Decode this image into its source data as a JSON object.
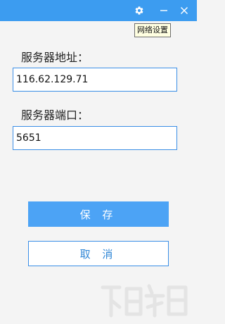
{
  "titlebar": {
    "bg_color": "#3c9cf0",
    "settings_icon": "gear-icon",
    "minimize_icon": "minimize-icon",
    "close_icon": "close-icon"
  },
  "tooltip": {
    "text": "网络设置"
  },
  "form": {
    "host_label": "服务器地址：",
    "host_value": "116.62.129.71",
    "port_label": "服务器端口：",
    "port_value": "5651"
  },
  "buttons": {
    "save_label": "保 存",
    "cancel_label": "取 消",
    "accent_color": "#4ca3f5"
  },
  "watermark": {
    "icon": "watermark-logo"
  }
}
